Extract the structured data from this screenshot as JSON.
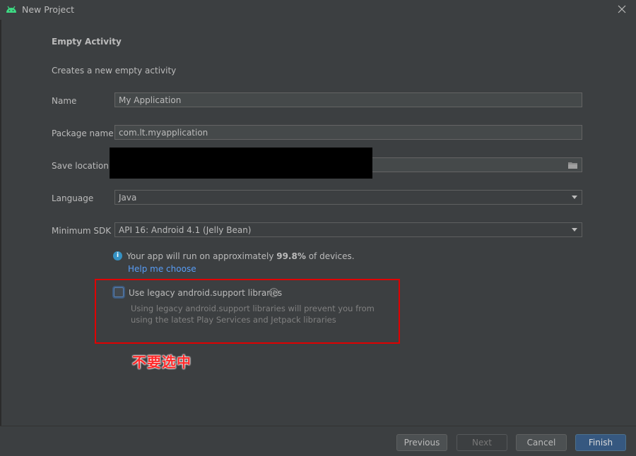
{
  "window": {
    "title": "New Project"
  },
  "form": {
    "heading": "Empty Activity",
    "description": "Creates a new empty activity",
    "name": {
      "label": "Name",
      "value": "My Application"
    },
    "package_name": {
      "label": "Package name",
      "value": "com.lt.myapplication"
    },
    "save_location": {
      "label": "Save location",
      "value": ""
    },
    "language": {
      "label": "Language",
      "value": "Java"
    },
    "minimum_sdk": {
      "label": "Minimum SDK",
      "value": "API 16: Android 4.1 (Jelly Bean)"
    }
  },
  "info": {
    "prefix": "Your app will run on approximately ",
    "percent": "99.8%",
    "suffix": " of devices.",
    "help_link": "Help me choose"
  },
  "legacy": {
    "checked": false,
    "label": "Use legacy android.support libraries",
    "description": "Using legacy android.support libraries will prevent you from using the latest Play Services and Jetpack libraries"
  },
  "annotation": {
    "text": "不要选中",
    "color": "#ff2a2a"
  },
  "buttons": {
    "previous": "Previous",
    "next": "Next",
    "cancel": "Cancel",
    "finish": "Finish"
  },
  "colors": {
    "background": "#3c3f41",
    "accent": "#365880",
    "link": "#589df6",
    "highlight": "#e00000"
  }
}
